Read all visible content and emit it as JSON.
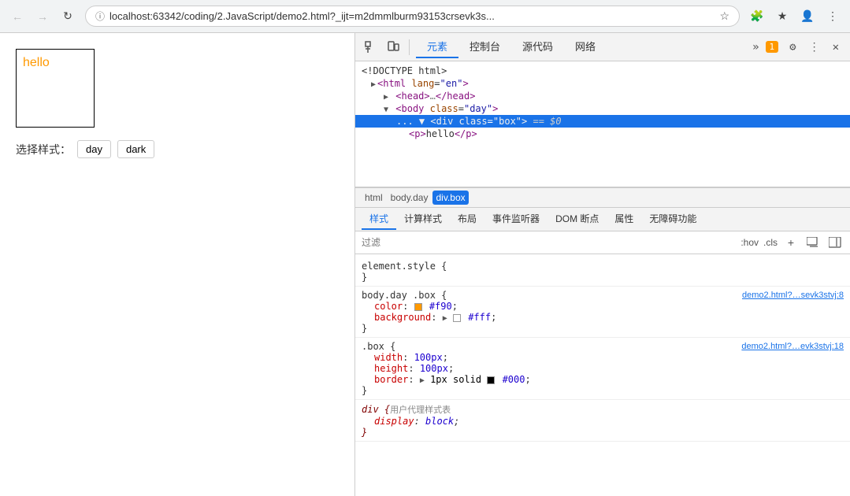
{
  "browser": {
    "address": "localhost:63342/coding/2.JavaScript/demo2.html?_ijt=m2dmmlburm93153crsevk3s...",
    "back_disabled": true,
    "forward_disabled": true
  },
  "page": {
    "demo_text": "hello",
    "style_label": "选择样式：",
    "btn_day": "day",
    "btn_dark": "dark"
  },
  "devtools": {
    "tabs": [
      "元素",
      "控制台",
      "源代码",
      "网络"
    ],
    "active_tab": "元素",
    "badge_count": "1",
    "elements": [
      {
        "indent": 0,
        "text": "<!DOCTYPE html>"
      },
      {
        "indent": 1,
        "text": "<html lang=\"en\">"
      },
      {
        "indent": 2,
        "text": "▶ <head>…</head>"
      },
      {
        "indent": 2,
        "text": "▼ <body class=\"day\">"
      },
      {
        "indent": 3,
        "text": "▼ <div class=\"box\"> == $0",
        "selected": true
      },
      {
        "indent": 4,
        "text": "<p>hello</p>"
      }
    ],
    "breadcrumb": [
      "html",
      "body.day",
      "div.box"
    ],
    "style_tabs": [
      "样式",
      "计算样式",
      "布局",
      "事件监听器",
      "DOM 断点",
      "属性",
      "无障碍功能"
    ],
    "active_style_tab": "样式",
    "filter_placeholder": "过滤",
    "filter_pseudo": ":hov",
    "filter_cls": ".cls",
    "css_rules": [
      {
        "selector": "element.style {",
        "close": "}",
        "props": [],
        "source": ""
      },
      {
        "selector": "body.day .box {",
        "close": "}",
        "props": [
          {
            "name": "color",
            "colon": ":",
            "value": "#f90",
            "swatch": "#ff9900"
          },
          {
            "name": "background",
            "colon": ":",
            "value": "▶ □#fff",
            "swatch": "#ffffff"
          }
        ],
        "source": "demo2.html?…sevk3stvj:8"
      },
      {
        "selector": ".box {",
        "close": "}",
        "props": [
          {
            "name": "width",
            "colon": ":",
            "value": "100px"
          },
          {
            "name": "height",
            "colon": ":",
            "value": "100px"
          },
          {
            "name": "border",
            "colon": ":",
            "value": "▶ 1px solid ■#000",
            "swatch": "#000000"
          }
        ],
        "source": "demo2.html?…evk3stvj:18"
      },
      {
        "selector": "div {",
        "close": "}",
        "props": [
          {
            "name": "display",
            "colon": ":",
            "value": "block",
            "italic": true
          }
        ],
        "source": "",
        "ua_label": "用户代理样式表"
      }
    ]
  }
}
